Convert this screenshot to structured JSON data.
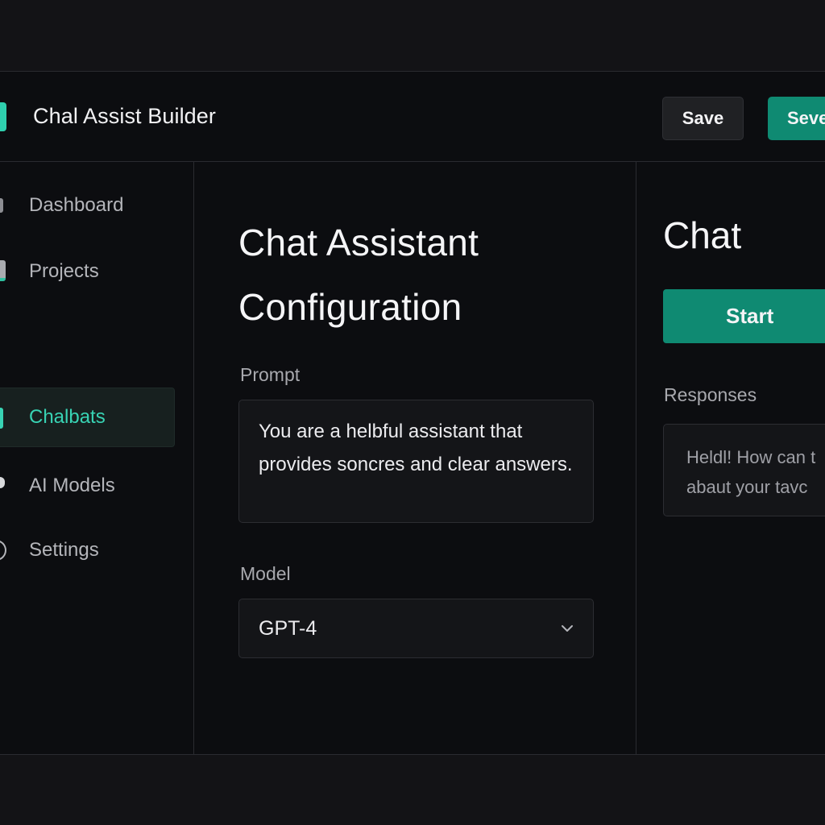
{
  "header": {
    "app_title": "Chal Assist Builder",
    "save_label": "Save",
    "secondary_save_label": "Seve"
  },
  "sidebar": {
    "items": [
      {
        "label": "Dashboard",
        "icon": "dashboard-icon",
        "active": false
      },
      {
        "label": "Projects",
        "icon": "folder-icon",
        "active": false
      },
      {
        "label": "Chalbats",
        "icon": "chatbot-icon",
        "active": true
      },
      {
        "label": "AI Models",
        "icon": "model-icon",
        "active": false
      },
      {
        "label": "Settings",
        "icon": "gear-icon",
        "active": false
      }
    ]
  },
  "config": {
    "title_line1": "Chat Assistant",
    "title_line2": "Configuration",
    "prompt_label": "Prompt",
    "prompt_value": "You are a helbful assistant that provides soncres and clear answers.",
    "model_label": "Model",
    "model_value": "GPT-4"
  },
  "chat": {
    "title": "Chat",
    "start_label": "Start",
    "responses_label": "Responses",
    "response_line1": "Heldl! How can t",
    "response_line2": "abaut your tavc"
  },
  "colors": {
    "accent": "#0f8a72",
    "accent_text": "#38d3b4",
    "background": "#0c0d10"
  }
}
